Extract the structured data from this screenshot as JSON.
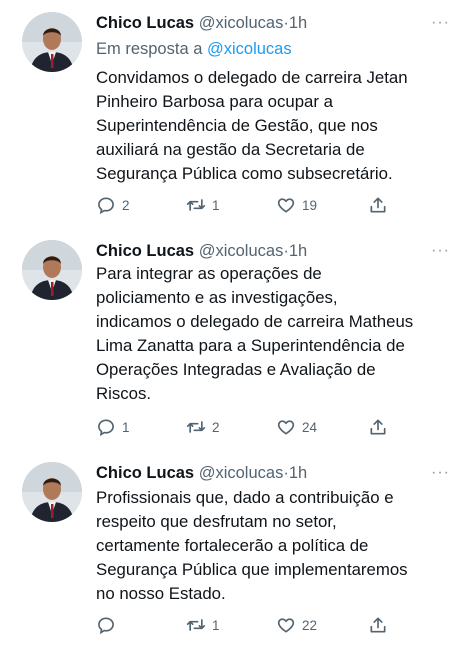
{
  "tweets": [
    {
      "name": "Chico Lucas",
      "handle": "@xicolucas",
      "dot": "·",
      "time": "1h",
      "more": "···",
      "reply_prefix": "Em resposta a",
      "reply_mention": "@xicolucas",
      "lines": [
        "Convidamos o delegado de carreira Jetan",
        "Pinheiro Barbosa para ocupar a",
        "Superintendência de Gestão, que nos",
        "auxiliará na gestão da Secretaria de",
        "Segurança Pública como subsecretário."
      ],
      "replies": "2",
      "retweets": "1",
      "likes": "19"
    },
    {
      "name": "Chico Lucas",
      "handle": "@xicolucas",
      "dot": "·",
      "time": "1h",
      "more": "···",
      "lines": [
        "Para integrar as operações de",
        "policiamento e as investigações,",
        "indicamos o delegado de carreira Matheus",
        "Lima Zanatta para a Superintendência de",
        "Operações Integradas e Avaliação de",
        "Riscos."
      ],
      "replies": "1",
      "retweets": "2",
      "likes": "24"
    },
    {
      "name": "Chico Lucas",
      "handle": "@xicolucas",
      "dot": "·",
      "time": "1h",
      "more": "···",
      "lines": [
        "Profissionais que, dado a contribuição e",
        "respeito que desfrutam no setor,",
        "certamente fortalecerão a política de",
        "Segurança Pública que implementaremos",
        "no nosso Estado."
      ],
      "replies": "",
      "retweets": "1",
      "likes": "22"
    }
  ],
  "colors": {
    "text": "#0f1419",
    "secondary": "#536471",
    "link": "#1d9bf0"
  },
  "icons": {
    "reply": "reply-icon",
    "retweet": "retweet-icon",
    "like": "heart-icon",
    "share": "share-icon",
    "more": "more-icon"
  }
}
